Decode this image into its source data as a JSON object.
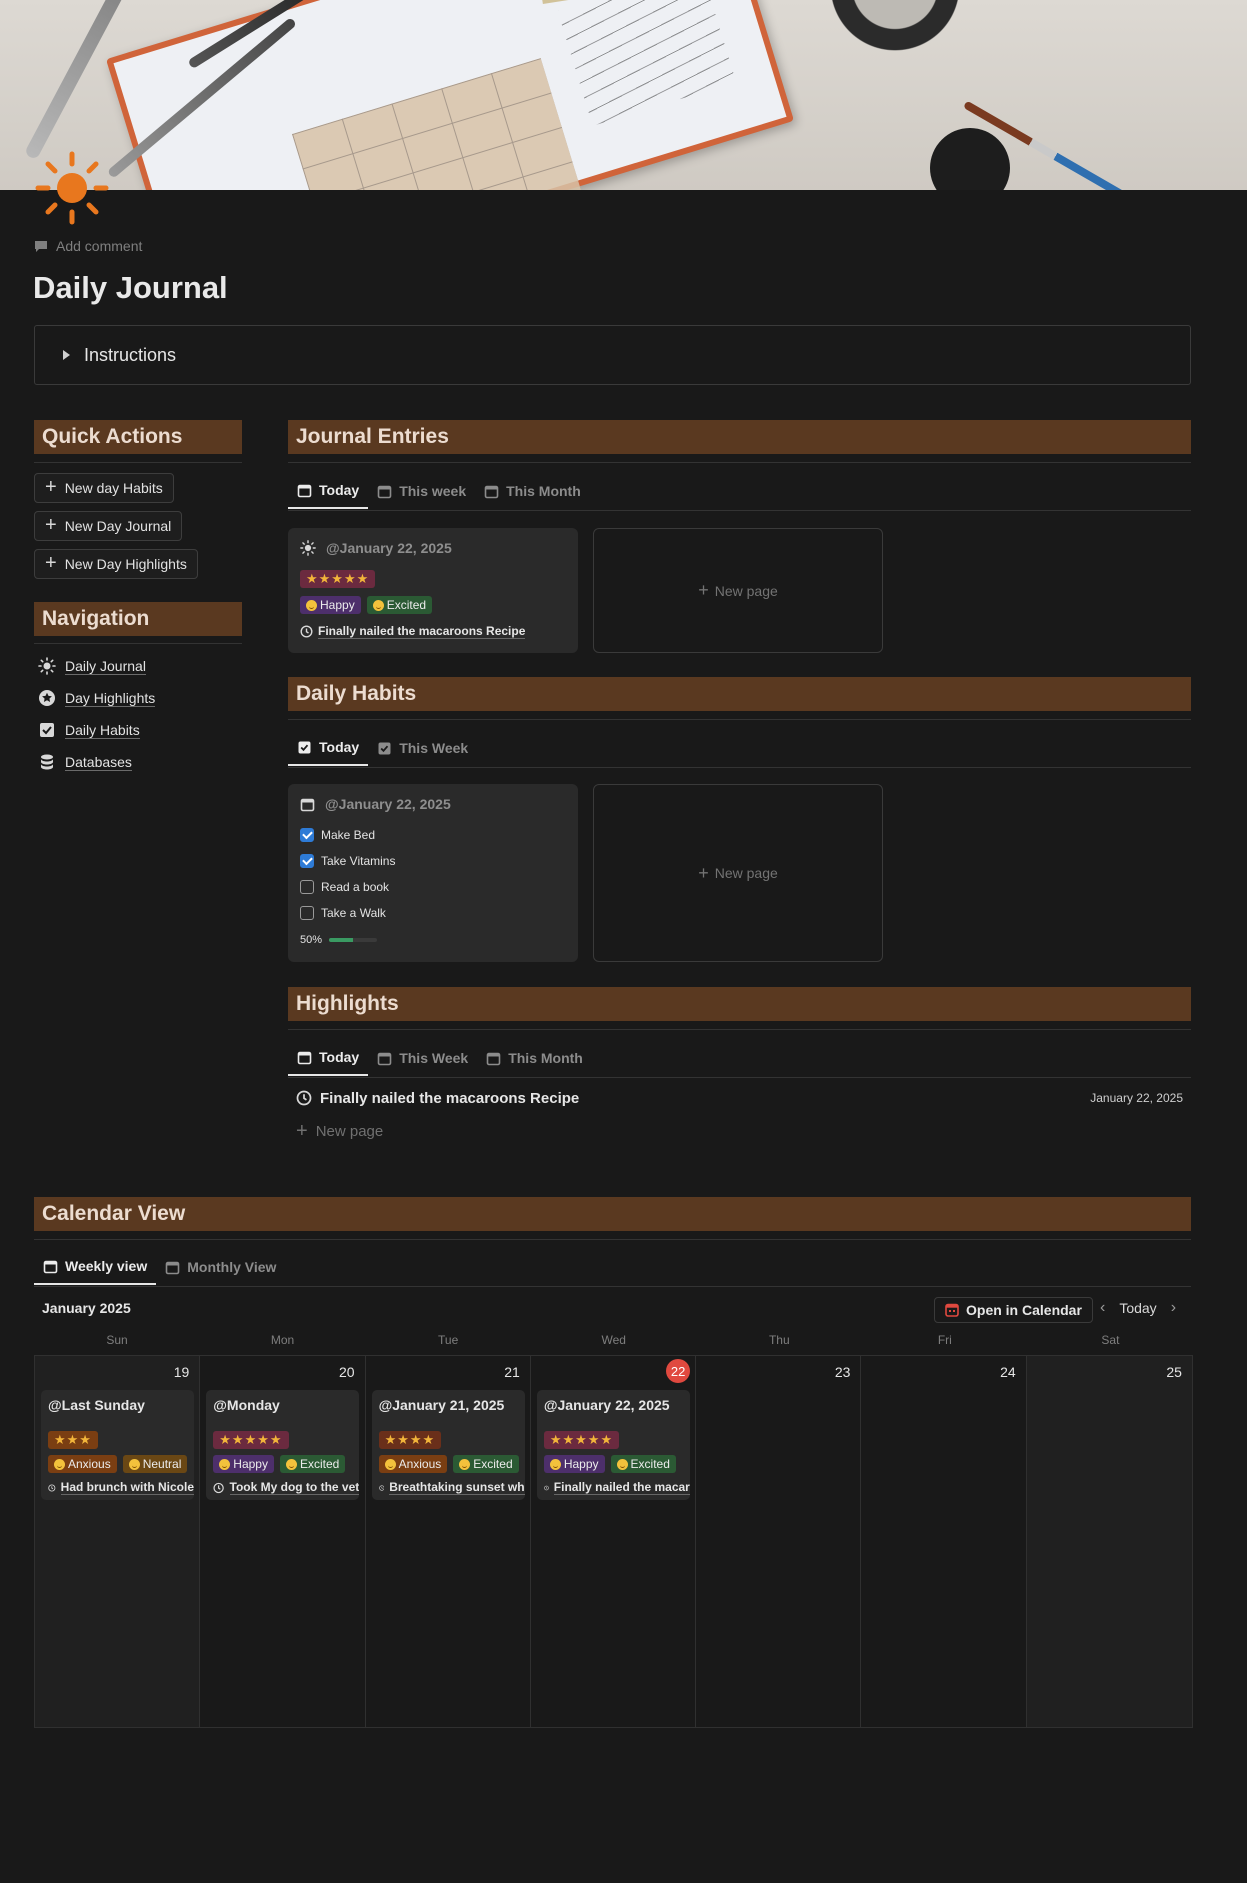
{
  "page": {
    "add_comment": "Add comment",
    "title": "Daily Journal",
    "instructions_label": "Instructions"
  },
  "quick_actions": {
    "heading": "Quick Actions",
    "buttons": [
      "New day Habits",
      "New Day Journal",
      "New Day Highlights"
    ]
  },
  "navigation": {
    "heading": "Navigation",
    "items": [
      {
        "label": "Daily Journal",
        "icon": "sun-icon"
      },
      {
        "label": "Day Highlights",
        "icon": "star-circle-icon"
      },
      {
        "label": "Daily Habits",
        "icon": "checkbox-icon"
      },
      {
        "label": "Databases",
        "icon": "database-icon"
      }
    ]
  },
  "journal": {
    "heading": "Journal Entries",
    "tabs": [
      "Today",
      "This week",
      "This Month"
    ],
    "card": {
      "date": "@January 22, 2025",
      "stars": "★★★★★",
      "tags": [
        "Happy",
        "Excited"
      ],
      "note": "Finally nailed the macaroons Recipe"
    },
    "new_page": "New page"
  },
  "habits": {
    "heading": "Daily Habits",
    "tabs": [
      "Today",
      "This Week"
    ],
    "card": {
      "date": "@January 22, 2025",
      "items": [
        {
          "label": "Make Bed",
          "checked": true
        },
        {
          "label": "Take Vitamins",
          "checked": true
        },
        {
          "label": "Read a book",
          "checked": false
        },
        {
          "label": "Take a Walk",
          "checked": false
        }
      ],
      "progress_label": "50%",
      "progress": 0.5
    },
    "new_page": "New page"
  },
  "highlights": {
    "heading": "Highlights",
    "tabs": [
      "Today",
      "This Week",
      "This Month"
    ],
    "row": {
      "title": "Finally nailed the macaroons Recipe",
      "date": "January 22, 2025"
    },
    "new_page": "New page"
  },
  "calendar": {
    "heading": "Calendar View",
    "tabs": [
      "Weekly view",
      "Monthly View"
    ],
    "month": "January 2025",
    "open_button": "Open in Calendar",
    "today_button": "Today",
    "weekdays": [
      "Sun",
      "Mon",
      "Tue",
      "Wed",
      "Thu",
      "Fri",
      "Sat"
    ],
    "days": [
      "19",
      "20",
      "21",
      "22",
      "23",
      "24",
      "25"
    ],
    "today_index": 3,
    "entries": [
      {
        "title": "@Last Sunday",
        "stars": "★★★",
        "stars_class": "s3",
        "tags": [
          {
            "label": "Anxious",
            "kind": "anxious"
          },
          {
            "label": "Neutral",
            "kind": "neutral"
          }
        ],
        "note": "Had brunch with Nicole"
      },
      {
        "title": "@Monday",
        "stars": "★★★★★",
        "stars_class": "s5",
        "tags": [
          {
            "label": "Happy",
            "kind": "happy"
          },
          {
            "label": "Excited",
            "kind": "excited"
          }
        ],
        "note": "Took My dog to the vet"
      },
      {
        "title": "@January 21, 2025",
        "stars": "★★★★",
        "stars_class": "s4",
        "tags": [
          {
            "label": "Anxious",
            "kind": "anxious"
          },
          {
            "label": "Excited",
            "kind": "excited"
          }
        ],
        "note": "Breathtaking sunset wh"
      },
      {
        "title": "@January 22, 2025",
        "stars": "★★★★★",
        "stars_class": "s5",
        "tags": [
          {
            "label": "Happy",
            "kind": "happy"
          },
          {
            "label": "Excited",
            "kind": "excited"
          }
        ],
        "note": "Finally nailed the macar"
      }
    ]
  },
  "colors": {
    "background": "#191919",
    "section_header": "#5a3920",
    "accent_blue": "#2e7bd6",
    "today_red": "#e0493f",
    "star_gold": "#f2b53a"
  }
}
